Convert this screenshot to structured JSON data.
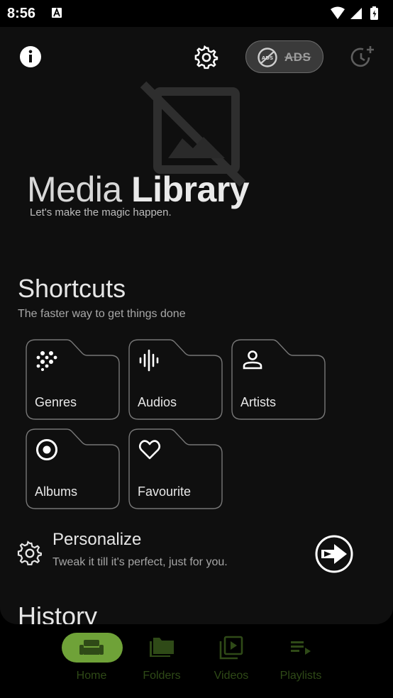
{
  "status_bar": {
    "time": "8:56"
  },
  "header": {
    "ads_label": "ADS"
  },
  "hero": {
    "title_light": "Media ",
    "title_bold": "Library",
    "subtitle": "Let's make the magic happen."
  },
  "shortcuts": {
    "title": "Shortcuts",
    "subtitle": "The faster way to get things done",
    "items": [
      {
        "label": "Genres",
        "icon": "genres-dots-icon"
      },
      {
        "label": "Audios",
        "icon": "audio-waveform-icon"
      },
      {
        "label": "Artists",
        "icon": "person-icon"
      },
      {
        "label": "Albums",
        "icon": "disc-icon"
      },
      {
        "label": "Favourite",
        "icon": "heart-icon"
      }
    ]
  },
  "personalize": {
    "title": "Personalize",
    "subtitle": "Tweak it till it's perfect, just for you."
  },
  "history": {
    "title": "History"
  },
  "bottom_nav": {
    "items": [
      {
        "label": "Home",
        "icon": "home-sofa-icon",
        "selected": true
      },
      {
        "label": "Folders",
        "icon": "folders-icon",
        "selected": false
      },
      {
        "label": "Videos",
        "icon": "video-library-icon",
        "selected": false
      },
      {
        "label": "Playlists",
        "icon": "playlist-icon",
        "selected": false
      }
    ]
  },
  "colors": {
    "accent": "#8bc34a",
    "nav_pill": "#6fa238",
    "background": "#0f0f0f"
  }
}
